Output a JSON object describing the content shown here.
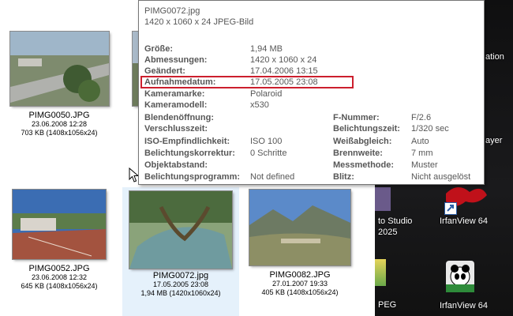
{
  "thumbnails": [
    {
      "name": "PIMG0050.JPG",
      "date": "23.06.2008 12:28",
      "size": "703 KB (1408x1056x24)"
    },
    {
      "name": "PIMG0052.JPG",
      "date": "23.06.2008 12:32",
      "size": "645 KB (1408x1056x24)"
    },
    {
      "name": "PIMG0072.jpg",
      "date": "17.05.2005 23:08",
      "size": "1,94 MB (1420x1060x24)"
    },
    {
      "name": "PIMG0082.JPG",
      "date": "27.01.2007 19:33",
      "size": "405 KB (1408x1056x24)"
    }
  ],
  "tooltip": {
    "filename": "PIMG0072.jpg",
    "subtitle": "1420 x 1060 x 24 JPEG-Bild",
    "rows": [
      {
        "label": "Größe:",
        "value": "1,94 MB"
      },
      {
        "label": "Abmessungen:",
        "value": "1420 x 1060 x 24"
      },
      {
        "label": "Geändert:",
        "value": "17.04.2006 13:15"
      },
      {
        "label": "Aufnahmedatum:",
        "value": "17.05.2005 23:08"
      },
      {
        "label": "Kameramarke:",
        "value": "Polaroid"
      },
      {
        "label": "Kameramodell:",
        "value": "x530"
      },
      {
        "label": "Blendenöffnung:",
        "value": "",
        "rlabel": "F-Nummer:",
        "rvalue": "F/2.6"
      },
      {
        "label": "Verschlusszeit:",
        "value": "",
        "rlabel": "Belichtungszeit:",
        "rvalue": "1/320 sec"
      },
      {
        "label": "ISO-Empfindlichkeit:",
        "value": "ISO 100",
        "rlabel": "Weißabgleich:",
        "rvalue": "Auto"
      },
      {
        "label": "Belichtungskorrektur:",
        "value": "0 Schritte",
        "rlabel": "Brennweite:",
        "rvalue": "7 mm"
      },
      {
        "label": "Objektabstand:",
        "value": "",
        "rlabel": "Messmethode:",
        "rvalue": "Muster"
      },
      {
        "label": "Belichtungsprogramm:",
        "value": "Not defined",
        "rlabel": "Blitz:",
        "rvalue": "Nicht ausgelöst"
      }
    ]
  },
  "desktop": {
    "partial_text_1": "ation",
    "partial_text_2": "ayer",
    "studio_line1": "to Studio",
    "studio_line2": "2025",
    "irfan1": "IrfanView 64",
    "irfan2": "IrfanView 64",
    "jpeg": "PEG"
  }
}
